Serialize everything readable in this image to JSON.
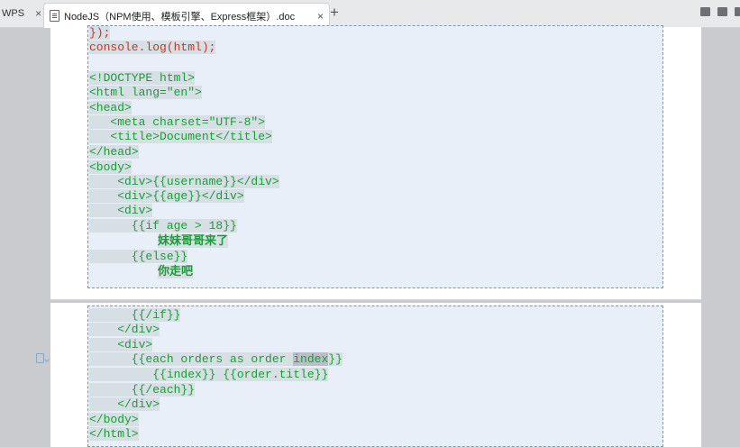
{
  "tabs": {
    "wps_label": "WPS",
    "close_glyph": "×",
    "doc_title": "NodeJS（NPM使用、模板引擎、Express框架）.doc",
    "new_tab_glyph": "+"
  },
  "code_page1": [
    {
      "text": "});",
      "color": "red"
    },
    {
      "text": "console.log(html);",
      "color": "red"
    },
    {
      "text": "",
      "color": "green"
    },
    {
      "text": "<!DOCTYPE html>",
      "color": "green"
    },
    {
      "text": "<html lang=\"en\">",
      "color": "green"
    },
    {
      "text": "<head>",
      "color": "green"
    },
    {
      "text": "   <meta charset=\"UTF-8\">",
      "color": "green"
    },
    {
      "text": "   <title>Document</title>",
      "color": "green"
    },
    {
      "text": "</head>",
      "color": "green"
    },
    {
      "text": "<body>",
      "color": "green"
    },
    {
      "text": "    <div>{{username}}</div>",
      "color": "green"
    },
    {
      "text": "    <div>{{age}}</div>",
      "color": "green"
    },
    {
      "text": "    <div>",
      "color": "green"
    },
    {
      "text": "      {{if age > 18}}",
      "color": "green"
    },
    {
      "text": "妹妹哥哥来了",
      "color": "cjk"
    },
    {
      "text": "      {{else}}",
      "color": "green"
    },
    {
      "text": "你走吧",
      "color": "cjk"
    }
  ],
  "code_page2": [
    {
      "text": "      {{/if}}"
    },
    {
      "text": "    </div>"
    },
    {
      "text": "    <div>"
    },
    {
      "pre": "      {{each orders as order ",
      "hl": "index",
      "post": "}}"
    },
    {
      "text": "         {{index}} {{order.title}}"
    },
    {
      "text": "      {{/each}}"
    },
    {
      "text": "    </div>"
    },
    {
      "text": "</body>"
    },
    {
      "text": "</html>"
    }
  ],
  "colors": {
    "code_red": "#c0392b",
    "code_green": "#1e9a3a",
    "code_block_bg": "#e8eff9"
  }
}
